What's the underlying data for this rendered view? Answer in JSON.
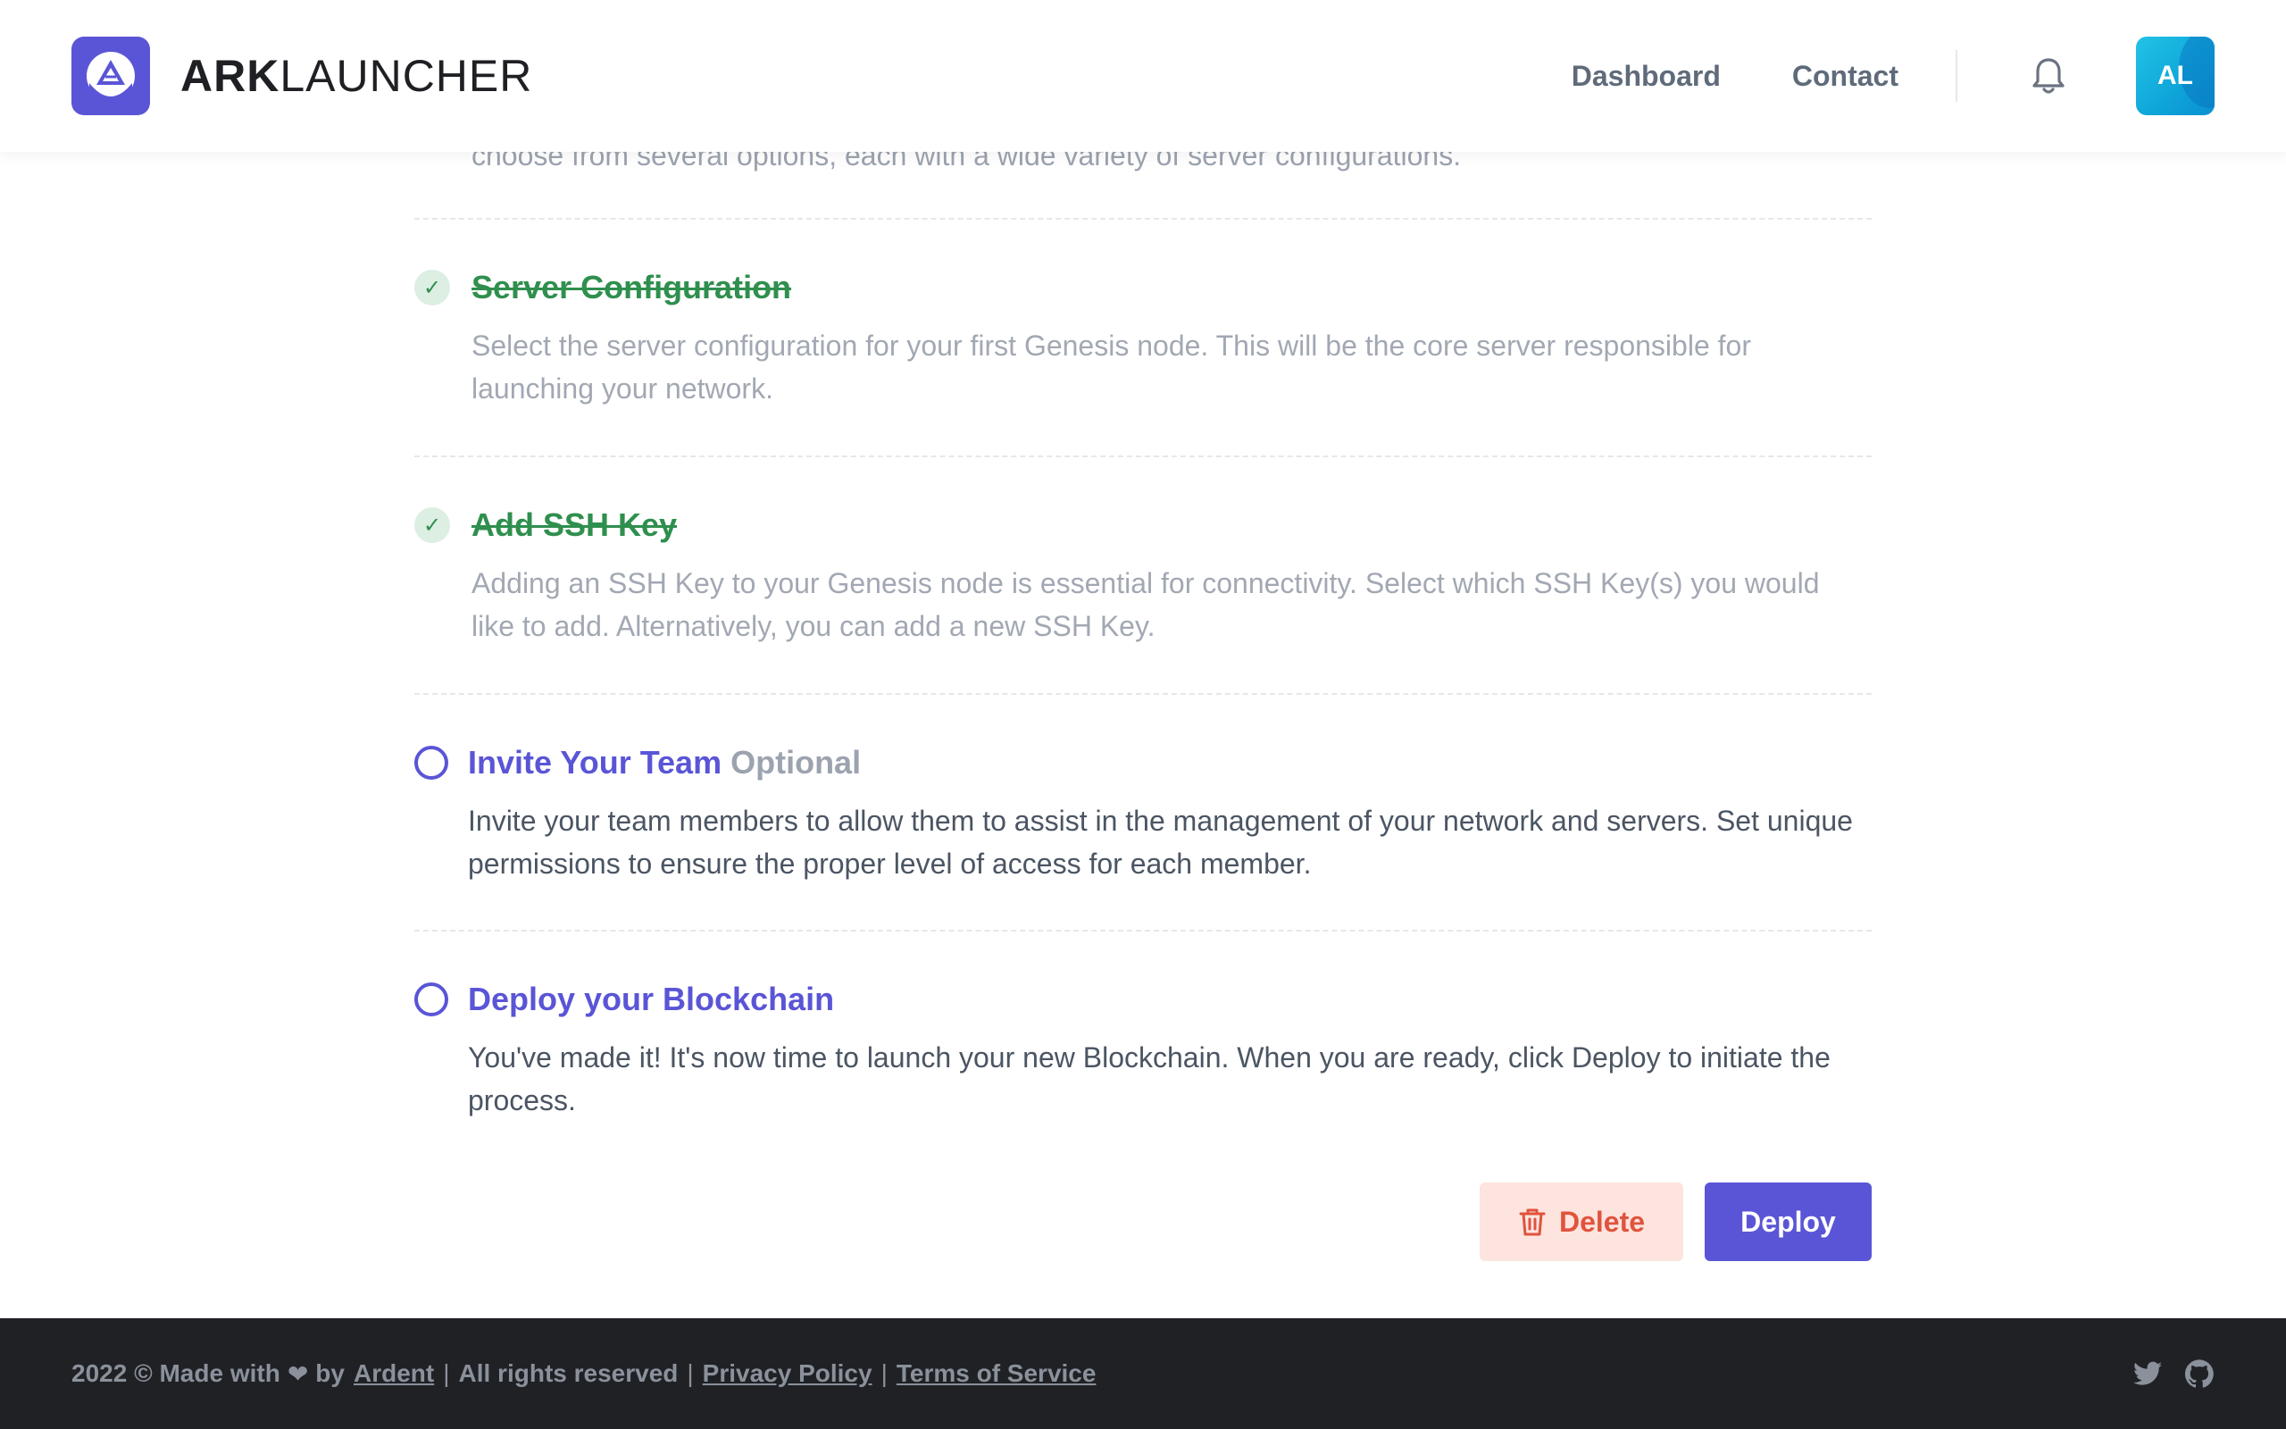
{
  "header": {
    "brand_bold": "ARK",
    "brand_light": "LAUNCHER",
    "nav": [
      "Dashboard",
      "Contact"
    ],
    "avatar_initials": "AL",
    "icons": {
      "logo": "ark-logo-icon",
      "notifications": "bell-icon"
    }
  },
  "steps": {
    "previous_desc_cut": "choose from several options, each with a wide variety of server configurations.",
    "items": [
      {
        "status": "done",
        "title": "Server Configuration",
        "desc": "Select the server configuration for your first Genesis node. This will be the core server responsible for launching your network."
      },
      {
        "status": "done",
        "title": "Add SSH Key",
        "desc": "Adding an SSH Key to your Genesis node is essential for connectivity. Select which SSH Key(s) you would like to add. Alternatively, you can add a new SSH Key."
      },
      {
        "status": "pending",
        "title": "Invite Your Team",
        "tag": "Optional",
        "desc": "Invite your team members to allow them to assist in the management of your network and servers. Set unique permissions to ensure the proper level of access for each member."
      },
      {
        "status": "pending",
        "title": "Deploy your Blockchain",
        "desc": "You've made it! It's now time to launch your new Blockchain. When you are ready, click Deploy to initiate the process."
      }
    ],
    "check_glyph": "✓"
  },
  "actions": {
    "delete": "Delete",
    "deploy": "Deploy"
  },
  "footer": {
    "copyright": "2022 © Made with",
    "heart": "❤",
    "by": "by",
    "company": "Ardent",
    "sep": "|",
    "rights": "All rights reserved",
    "privacy": "Privacy Policy",
    "terms": "Terms of Service",
    "social_icons": [
      "twitter-icon",
      "github-icon"
    ]
  },
  "colors": {
    "accent": "#5a55d6",
    "success": "#2f8f4e",
    "danger": "#e0533d",
    "danger_bg": "#fde4de",
    "footer_bg": "#1f2125",
    "avatar": "#0ea5d9"
  }
}
